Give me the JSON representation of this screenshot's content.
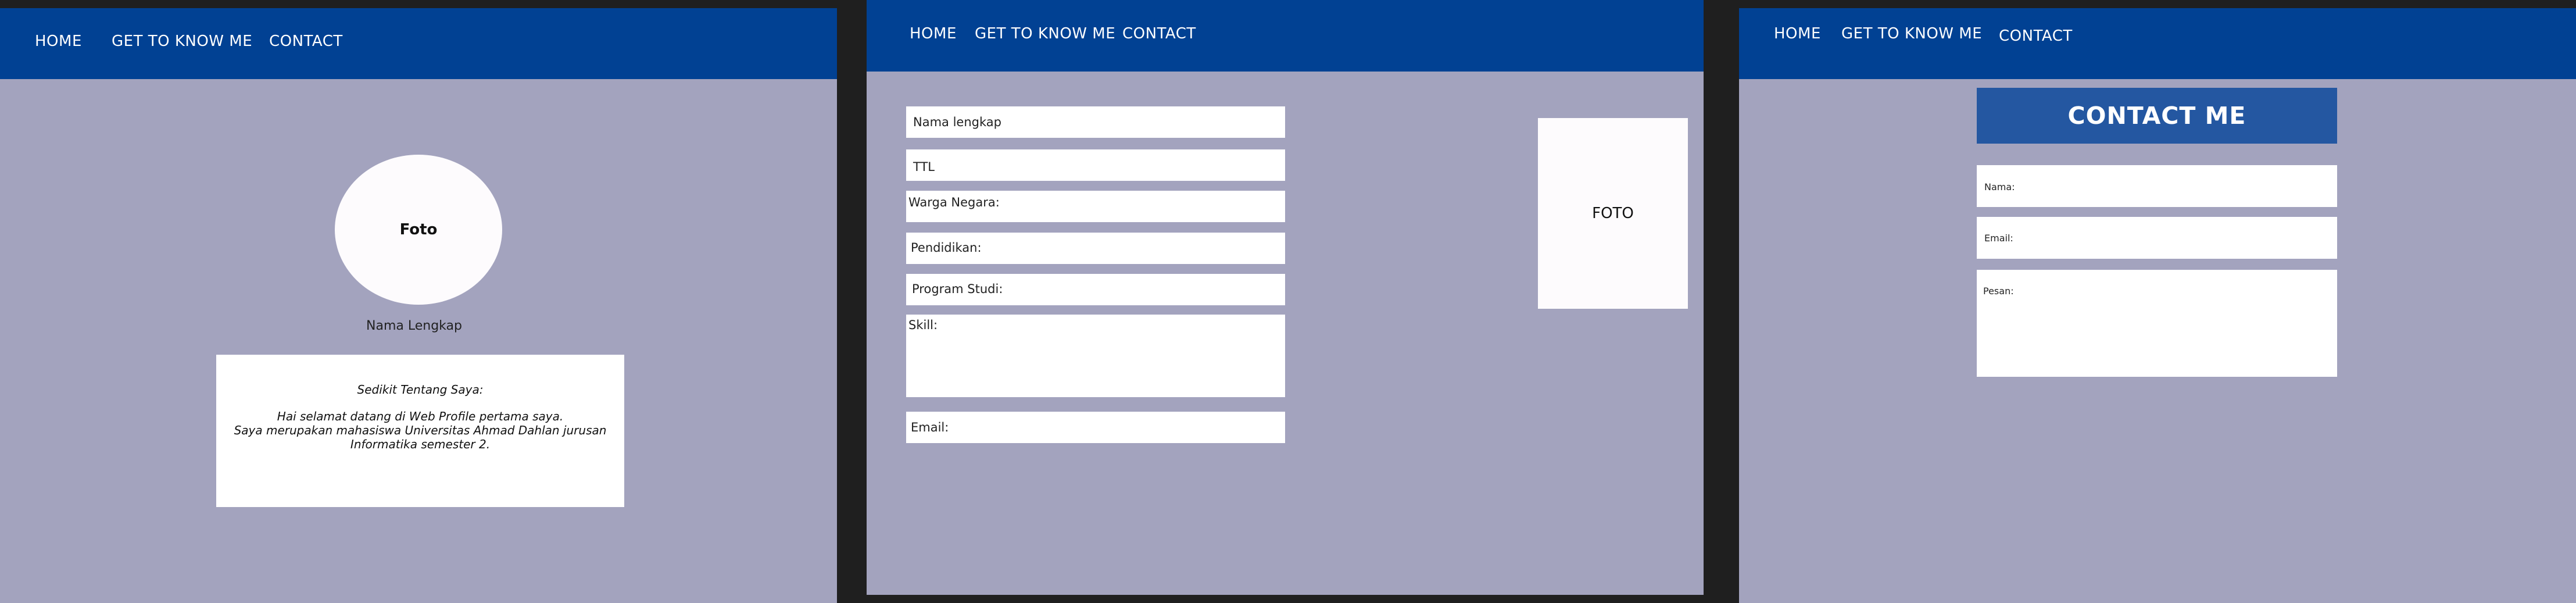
{
  "pages": [
    {
      "nav": {
        "home": "HOME",
        "about": "GET TO KNOW ME",
        "contact": "CONTACT"
      },
      "photo_label": "Foto",
      "name_label": "Nama Lengkap",
      "about": {
        "title": "Sedikit Tentang Saya:",
        "line1": "Hai selamat datang di Web Profile pertama saya.",
        "line2": "Saya merupakan mahasiswa Universitas Ahmad Dahlan jurusan",
        "line3": "Informatika semester 2."
      }
    },
    {
      "nav": {
        "home": "HOME",
        "about": "GET TO KNOW ME",
        "contact": "CONTACT"
      },
      "fields": {
        "nama": "Nama lengkap",
        "ttl": "TTL",
        "warga": "Warga Negara:",
        "pendidikan": "Pendidikan:",
        "prodi": "Program Studi:",
        "skill": "Skill:",
        "email": "Email:"
      },
      "photo_label": "FOTO"
    },
    {
      "nav": {
        "home": "HOME",
        "about": "GET TO KNOW ME",
        "contact": "CONTACT"
      },
      "title": "CONTACT ME",
      "form": {
        "nama": "Nama:",
        "email": "Email:",
        "pesan": "Pesan:"
      }
    }
  ],
  "colors": {
    "navbar": "#014193",
    "page_bg": "#a3a3be",
    "outer_bg": "#1f1f1f",
    "heading_bg": "#2457a1",
    "photo_bg": "#fdfbfd"
  }
}
